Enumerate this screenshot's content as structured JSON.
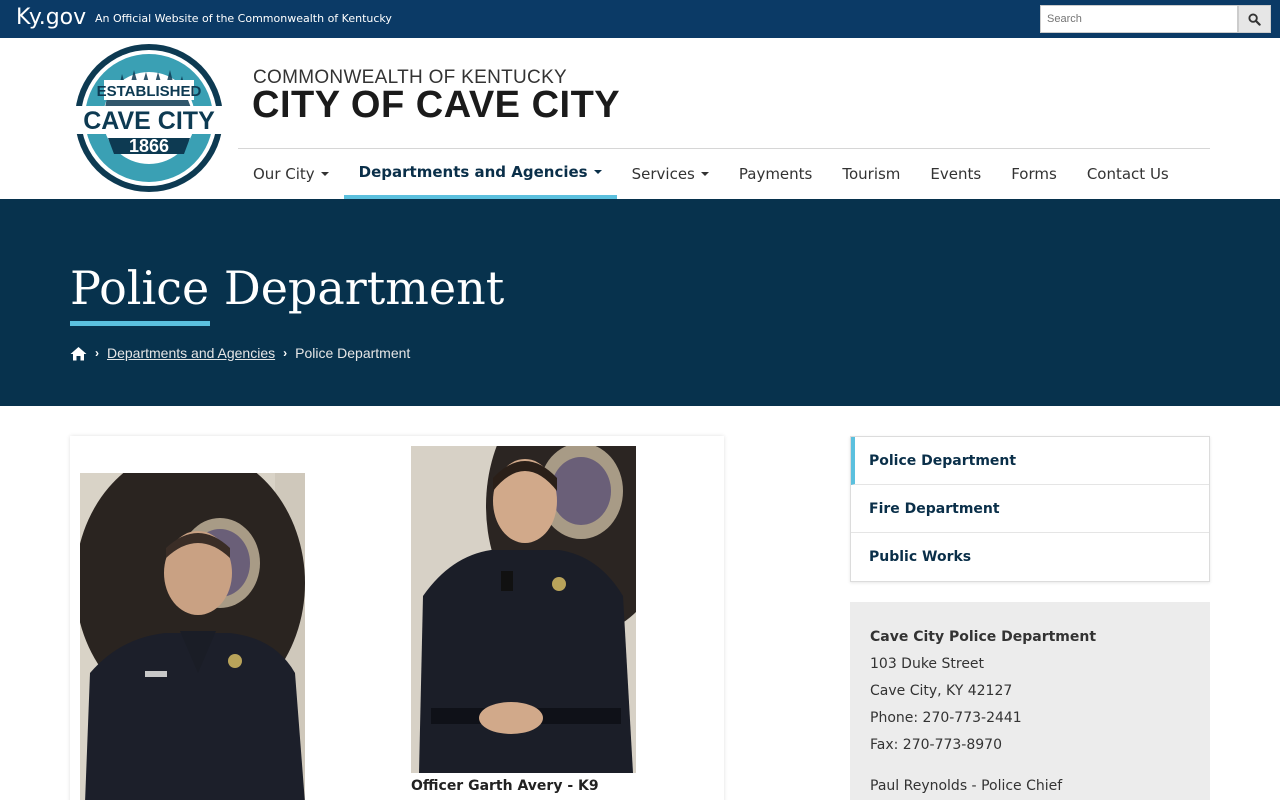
{
  "ky_bar": {
    "brand": "Ky.gov",
    "tagline": "An Official Website of the Commonwealth of Kentucky",
    "search_placeholder": "Search"
  },
  "header": {
    "logo": {
      "top_text": "ESTABLISHED",
      "name": "CAVE CITY",
      "year": "1866"
    },
    "commonwealth": "COMMONWEALTH OF KENTUCKY",
    "city_name": "CITY OF CAVE CITY"
  },
  "nav": {
    "items": [
      {
        "label": "Our City",
        "dropdown": true
      },
      {
        "label": "Departments and Agencies",
        "dropdown": true,
        "active": true
      },
      {
        "label": "Services",
        "dropdown": true
      },
      {
        "label": "Payments"
      },
      {
        "label": "Tourism"
      },
      {
        "label": "Events"
      },
      {
        "label": "Forms"
      },
      {
        "label": "Contact Us"
      }
    ]
  },
  "hero": {
    "title": "Police Department",
    "breadcrumbs": [
      {
        "label": "Departments and Agencies"
      },
      {
        "label": "Police Department"
      }
    ]
  },
  "content": {
    "photos": [
      {
        "caption": ""
      },
      {
        "caption": "Officer Garth Avery - K9"
      }
    ]
  },
  "sidebar": {
    "links": [
      "Police Department",
      "Fire Department",
      "Public Works"
    ],
    "contact": {
      "title": "Cave City Police Department",
      "street": "103 Duke Street",
      "city": "Cave City, KY 42127",
      "phone": "Phone: 270-773-2441",
      "fax": "Fax: 270-773-8970",
      "chief": "Paul Reynolds - Police Chief"
    }
  },
  "colors": {
    "ky_bar": "#0b3a66",
    "hero": "#07324d",
    "accent": "#5bc0de",
    "nav_active": "#0a2f49"
  }
}
